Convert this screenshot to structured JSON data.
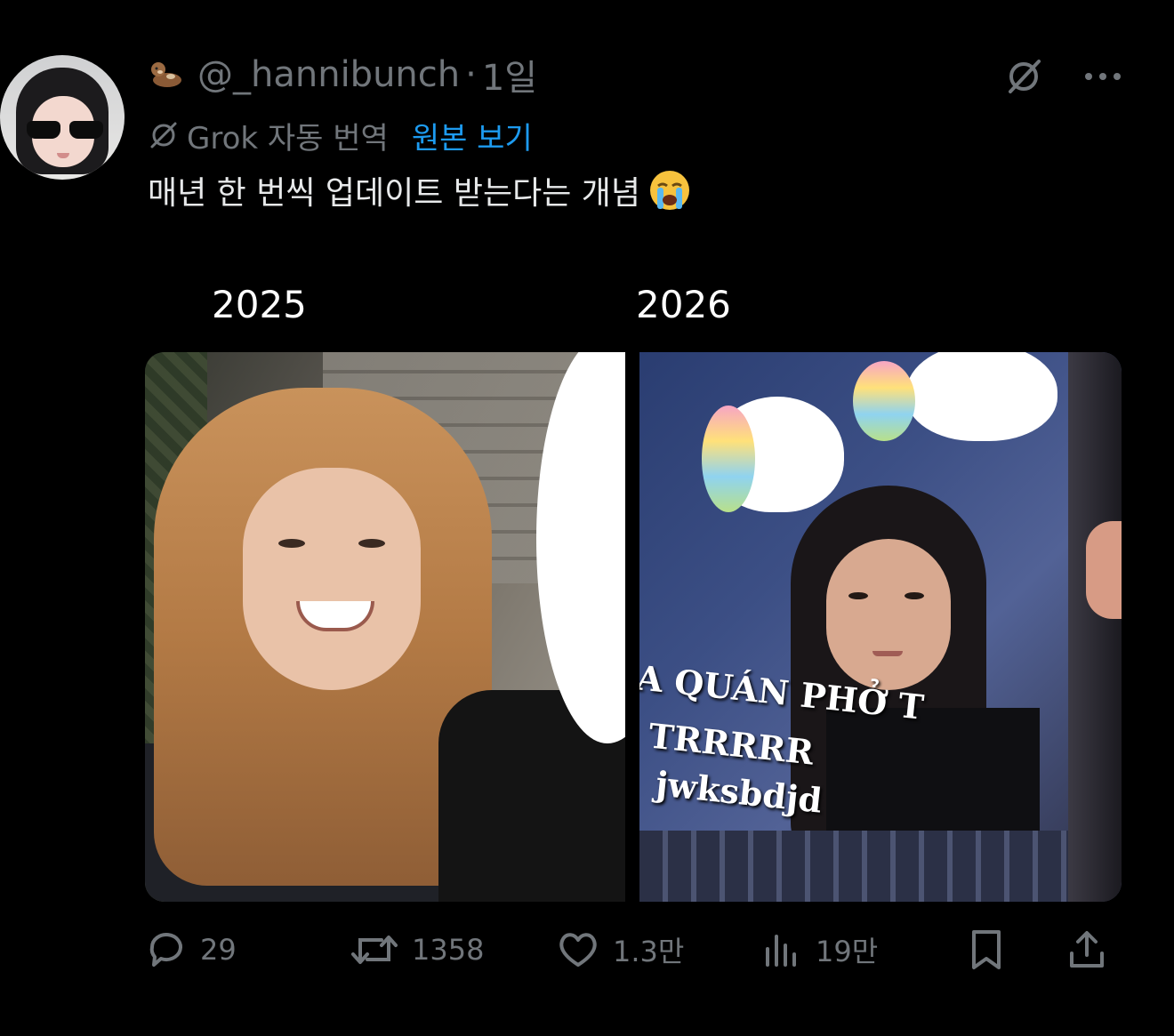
{
  "post": {
    "username": "@_hannibunch",
    "separator": "·",
    "time": "1일",
    "translation_label": "Grok 자동 번역",
    "show_original": "원본 보기",
    "text": "매년 한 번씩 업데이트 받는다는 개념"
  },
  "media": {
    "labels": [
      "2025",
      "2026"
    ],
    "overlay_lines": [
      "A QUÁN PHỞ T",
      "TRRRRR",
      "jwksbdjd"
    ]
  },
  "actions": {
    "replies": "29",
    "reposts": "1358",
    "likes": "1.3만",
    "views": "19만"
  },
  "colors": {
    "background": "#000000",
    "text_primary": "#e7e9ea",
    "text_secondary": "#71767b",
    "link": "#1d9bf0"
  },
  "icons": [
    "otter-emoji-icon",
    "grok-icon",
    "loudly-crying-face-emoji",
    "grok-slash-icon",
    "more-icon",
    "reply-icon",
    "repost-icon",
    "like-icon",
    "views-icon",
    "bookmark-icon",
    "share-icon"
  ]
}
